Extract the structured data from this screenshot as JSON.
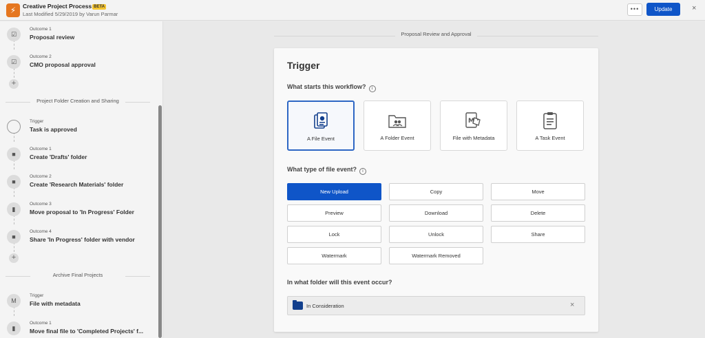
{
  "header": {
    "title": "Creative Project Process",
    "badge": "BETA",
    "subtitle": "Last Modified 5/29/2019 by Varun Parmar",
    "more_label": "•••",
    "update_label": "Update",
    "close_label": "×"
  },
  "sidebar": {
    "add_label": "+",
    "group1": {
      "steps": [
        {
          "kind": "Outcome 1",
          "title": "Proposal review"
        },
        {
          "kind": "Outcome 2",
          "title": "CMO proposal approval"
        }
      ]
    },
    "group2": {
      "heading": "Project Folder Creation and Sharing",
      "steps": [
        {
          "kind": "Trigger",
          "title": "Task is approved"
        },
        {
          "kind": "Outcome 1",
          "title": "Create 'Drafts' folder"
        },
        {
          "kind": "Outcome 2",
          "title": "Create 'Research Materials' folder"
        },
        {
          "kind": "Outcome 3",
          "title": "Move proposal to 'In Progress' Folder"
        },
        {
          "kind": "Outcome 4",
          "title": "Share 'In Progress' folder with vendor"
        }
      ]
    },
    "group3": {
      "heading": "Archive Final Projects",
      "steps": [
        {
          "kind": "Trigger",
          "title": "File with metadata"
        },
        {
          "kind": "Outcome 1",
          "title": "Move final file to 'Completed Projects' f..."
        }
      ]
    }
  },
  "main": {
    "stage_label": "Proposal Review and Approval",
    "panel_title": "Trigger",
    "q1": "What starts this workflow?",
    "info_glyph": "i",
    "start_options": [
      {
        "label": "A File Event",
        "selected": true
      },
      {
        "label": "A Folder Event",
        "selected": false
      },
      {
        "label": "File with Metadata",
        "selected": false
      },
      {
        "label": "A Task Event",
        "selected": false
      }
    ],
    "q2": "What type of file event?",
    "file_events": [
      {
        "label": "New Upload",
        "selected": true
      },
      {
        "label": "Copy"
      },
      {
        "label": "Move"
      },
      {
        "label": "Preview"
      },
      {
        "label": "Download"
      },
      {
        "label": "Delete"
      },
      {
        "label": "Lock"
      },
      {
        "label": "Unlock"
      },
      {
        "label": "Share"
      },
      {
        "label": "Watermark"
      },
      {
        "label": "Watermark Removed"
      }
    ],
    "q3": "In what folder will this event occur?",
    "folder_value": "In Consideration",
    "folder_clear": "×"
  },
  "colors": {
    "accent": "#0f55c8",
    "app_icon": "#e5761f",
    "beta": "#f4c430",
    "folder_icon": "#123f8d"
  }
}
